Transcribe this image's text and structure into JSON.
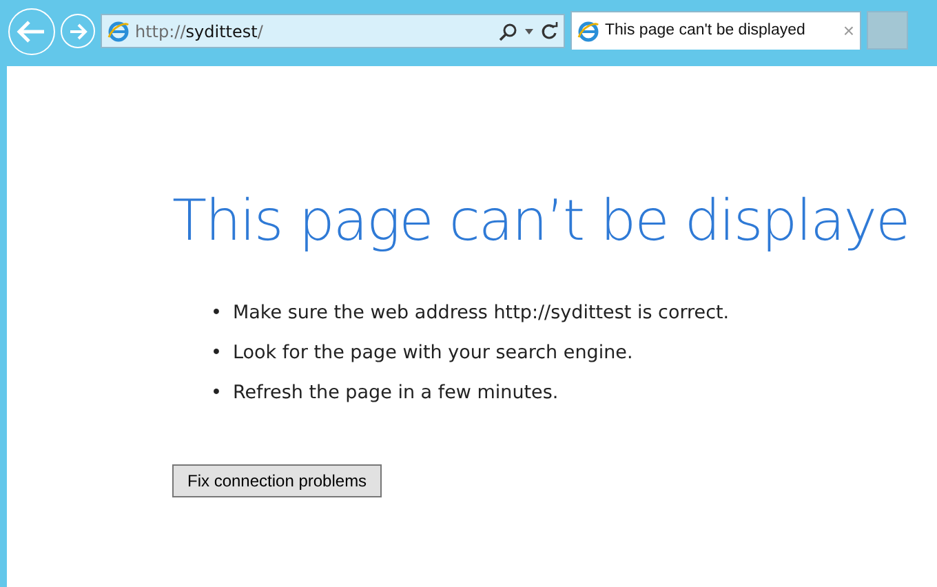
{
  "toolbar": {
    "address": {
      "scheme": "http://",
      "host": "sydittest",
      "path": "/"
    }
  },
  "tabs": [
    {
      "label": "This page can't be displayed",
      "close": "×",
      "selected": true
    }
  ],
  "page": {
    "heading": "This page can’t be displaye",
    "bullets": [
      {
        "marker": "•",
        "text": "Make sure the web address http://sydittest is correct."
      },
      {
        "marker": "•",
        "text": "Look for the page with your search engine."
      },
      {
        "marker": "•",
        "text": "Refresh the page in a few minutes."
      }
    ],
    "button": "Fix connection problems"
  }
}
